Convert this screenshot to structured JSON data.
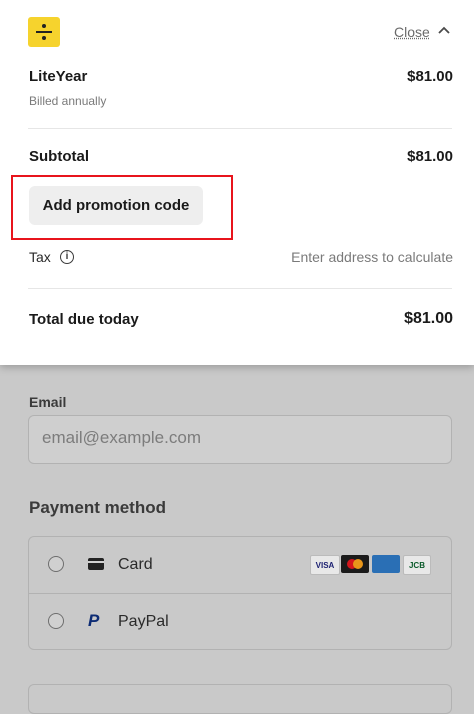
{
  "header": {
    "logo_icon": "divide-icon",
    "logo_color": "#F6D32D",
    "close_label": "Close"
  },
  "order": {
    "product_name": "LiteYear",
    "product_price": "$81.00",
    "billing_note": "Billed annually",
    "subtotal_label": "Subtotal",
    "subtotal_value": "$81.00",
    "promo_button_label": "Add promotion code",
    "tax_label": "Tax",
    "tax_value": "Enter address to calculate",
    "total_label": "Total due today",
    "total_value": "$81.00"
  },
  "form": {
    "email_label": "Email",
    "email_placeholder": "email@example.com",
    "payment_title": "Payment method",
    "payment_options": [
      {
        "label": "Card",
        "icon": "card-icon"
      },
      {
        "label": "PayPal",
        "icon": "paypal-icon"
      }
    ],
    "card_brands": [
      "VISA",
      "JCB"
    ]
  },
  "highlight_color": "#E8141C"
}
